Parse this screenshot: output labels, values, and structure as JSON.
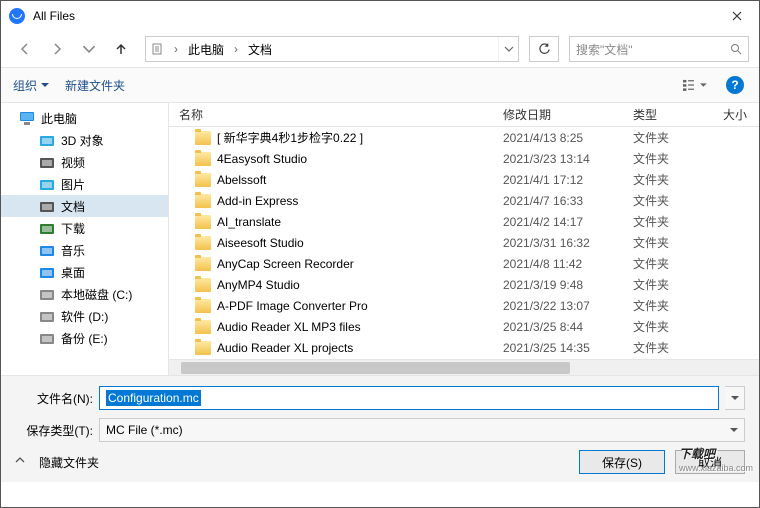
{
  "window": {
    "title": "All Files"
  },
  "breadcrumb": {
    "items": [
      "此电脑",
      "文档"
    ]
  },
  "search": {
    "placeholder": "搜索\"文档\""
  },
  "toolbar": {
    "organize": "组织",
    "new_folder": "新建文件夹"
  },
  "sidebar": {
    "root": "此电脑",
    "items": [
      {
        "label": "3D 对象",
        "color": "#2aa9e0"
      },
      {
        "label": "视频",
        "color": "#555"
      },
      {
        "label": "图片",
        "color": "#2aa9e0"
      },
      {
        "label": "文档",
        "color": "#555",
        "selected": true
      },
      {
        "label": "下载",
        "color": "#2e7d32"
      },
      {
        "label": "音乐",
        "color": "#1e88e5"
      },
      {
        "label": "桌面",
        "color": "#1e88e5"
      },
      {
        "label": "本地磁盘 (C:)",
        "color": "#888"
      },
      {
        "label": "软件 (D:)",
        "color": "#888"
      },
      {
        "label": "备份 (E:)",
        "color": "#888"
      }
    ]
  },
  "columns": {
    "name": "名称",
    "date": "修改日期",
    "type": "类型",
    "size": "大小"
  },
  "files": [
    {
      "name": "[ 新华字典4秒1步检字0.22 ]",
      "date": "2021/4/13 8:25",
      "type": "文件夹"
    },
    {
      "name": "4Easysoft Studio",
      "date": "2021/3/23 13:14",
      "type": "文件夹"
    },
    {
      "name": "Abelssoft",
      "date": "2021/4/1 17:12",
      "type": "文件夹"
    },
    {
      "name": "Add-in Express",
      "date": "2021/4/7 16:33",
      "type": "文件夹"
    },
    {
      "name": "AI_translate",
      "date": "2021/4/2 14:17",
      "type": "文件夹"
    },
    {
      "name": "Aiseesoft Studio",
      "date": "2021/3/31 16:32",
      "type": "文件夹"
    },
    {
      "name": "AnyCap Screen Recorder",
      "date": "2021/4/8 11:42",
      "type": "文件夹"
    },
    {
      "name": "AnyMP4 Studio",
      "date": "2021/3/19 9:48",
      "type": "文件夹"
    },
    {
      "name": "A-PDF Image Converter Pro",
      "date": "2021/3/22 13:07",
      "type": "文件夹"
    },
    {
      "name": "Audio Reader XL MP3 files",
      "date": "2021/3/25 8:44",
      "type": "文件夹"
    },
    {
      "name": "Audio Reader XL projects",
      "date": "2021/3/25 14:35",
      "type": "文件夹"
    }
  ],
  "form": {
    "filename_label": "文件名(N):",
    "filename_value": "Configuration.mc",
    "type_label": "保存类型(T):",
    "type_value": "MC File (*.mc)"
  },
  "actions": {
    "hide_folders": "隐藏文件夹",
    "save": "保存(S)",
    "cancel": "取消"
  },
  "watermark": {
    "big": "下载吧",
    "small": "www.xiazaiba.com"
  }
}
